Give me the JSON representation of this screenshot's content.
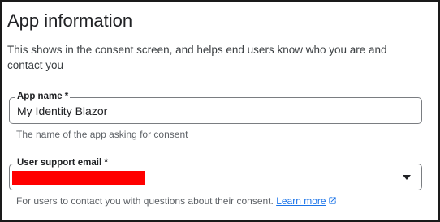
{
  "section": {
    "title": "App information",
    "description": "This shows in the consent screen, and helps end users know who you are and contact you"
  },
  "app_name": {
    "label": "App name *",
    "value": "My Identity Blazor",
    "helper": "The name of the app asking for consent"
  },
  "support_email": {
    "label": "User support email *",
    "value_redacted": true,
    "helper": "For users to contact you with questions about their consent.",
    "link_label": "Learn more",
    "redaction_color": "#ff0000",
    "dropdown_icon": "arrow-drop-down-icon",
    "link_icon": "open-in-new-icon"
  },
  "colors": {
    "link": "#1a73e8",
    "helper_text": "#5f6368",
    "field_border": "#7a7d81"
  }
}
